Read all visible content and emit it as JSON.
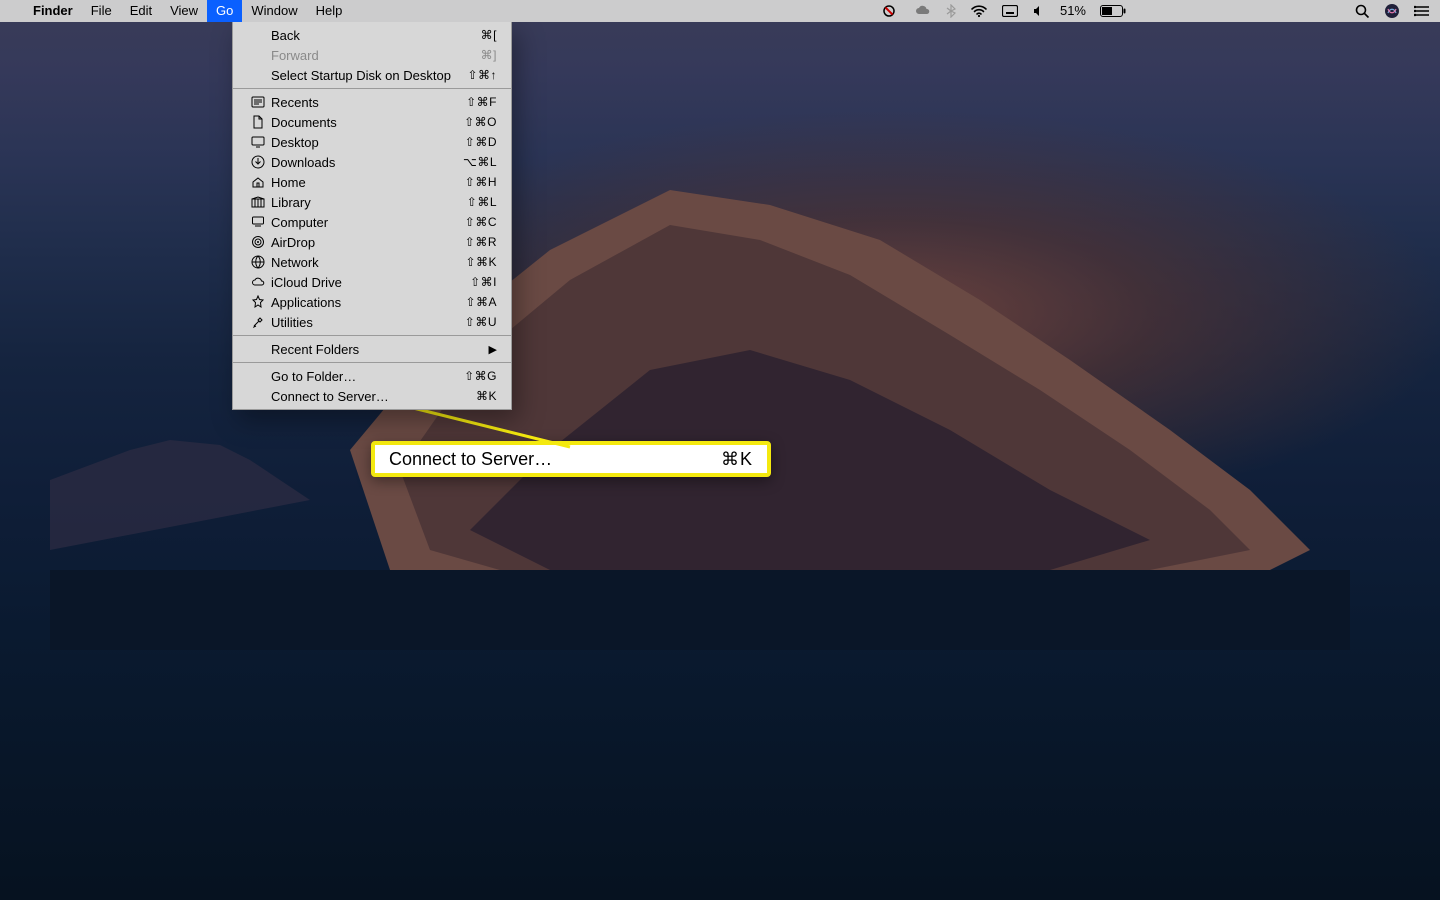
{
  "menubar": {
    "apple": "",
    "appname": "Finder",
    "items": [
      {
        "label": "File"
      },
      {
        "label": "Edit"
      },
      {
        "label": "View"
      },
      {
        "label": "Go",
        "active": true
      },
      {
        "label": "Window"
      },
      {
        "label": "Help"
      }
    ],
    "battery_text": "51%"
  },
  "go_menu": {
    "section1": [
      {
        "label": "Back",
        "shortcut": "⌘[",
        "disabled": false
      },
      {
        "label": "Forward",
        "shortcut": "⌘]",
        "disabled": true
      },
      {
        "label": "Select Startup Disk on Desktop",
        "shortcut": "⇧⌘↑",
        "disabled": false
      }
    ],
    "section2": [
      {
        "icon": "recents",
        "label": "Recents",
        "shortcut": "⇧⌘F"
      },
      {
        "icon": "documents",
        "label": "Documents",
        "shortcut": "⇧⌘O"
      },
      {
        "icon": "desktop",
        "label": "Desktop",
        "shortcut": "⇧⌘D"
      },
      {
        "icon": "downloads",
        "label": "Downloads",
        "shortcut": "⌥⌘L"
      },
      {
        "icon": "home",
        "label": "Home",
        "shortcut": "⇧⌘H"
      },
      {
        "icon": "library",
        "label": "Library",
        "shortcut": "⇧⌘L"
      },
      {
        "icon": "computer",
        "label": "Computer",
        "shortcut": "⇧⌘C"
      },
      {
        "icon": "airdrop",
        "label": "AirDrop",
        "shortcut": "⇧⌘R"
      },
      {
        "icon": "network",
        "label": "Network",
        "shortcut": "⇧⌘K"
      },
      {
        "icon": "icloud",
        "label": "iCloud Drive",
        "shortcut": "⇧⌘I"
      },
      {
        "icon": "applications",
        "label": "Applications",
        "shortcut": "⇧⌘A"
      },
      {
        "icon": "utilities",
        "label": "Utilities",
        "shortcut": "⇧⌘U"
      }
    ],
    "section3": [
      {
        "label": "Recent Folders",
        "submenu": true
      }
    ],
    "section4": [
      {
        "label": "Go to Folder…",
        "shortcut": "⇧⌘G"
      },
      {
        "label": "Connect to Server…",
        "shortcut": "⌘K"
      }
    ]
  },
  "callout": {
    "label": "Connect to Server…",
    "shortcut": "⌘K"
  }
}
